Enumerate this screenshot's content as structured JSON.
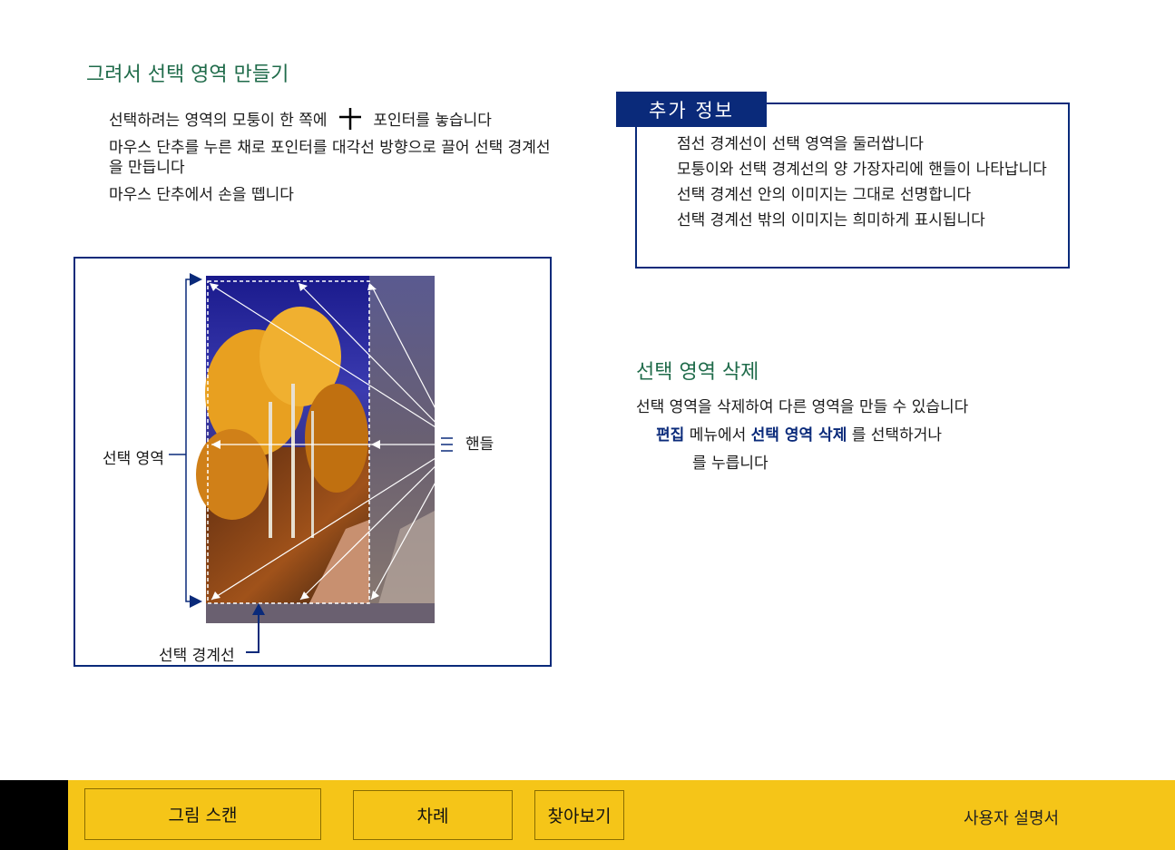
{
  "left_section": {
    "heading": "그려서 선택 영역 만들기",
    "step1_before": "선택하려는 영역의 모퉁이 한 쪽에",
    "step1_after": "포인터를 놓습니다",
    "step2": "마우스 단추를 누른 채로 포인터를 대각선 방향으로 끌어 선택 경계선을 만듭니다",
    "step3": "마우스 단추에서 손을 뗍니다"
  },
  "figure": {
    "label_selection": "선택 영역",
    "label_handles": "핸들",
    "label_marquee": "선택 경계선"
  },
  "info_box": {
    "title": "추가 정보",
    "items": [
      "점선 경계선이 선택 영역을 둘러쌉니다",
      "모퉁이와 선택 경계선의 양 가장자리에 핸들이 나타납니다",
      "선택 경계선 안의 이미지는 그대로 선명합니다",
      "선택 경계선 밖의 이미지는 희미하게 표시됩니다"
    ]
  },
  "delete_section": {
    "heading": "선택 영역 삭제",
    "description": "선택 영역을 삭제하여 다른 영역을 만들 수 있습니다",
    "menu_edit": "편집",
    "step_mid": "메뉴에서",
    "menu_delete": "선택 영역 삭제",
    "step_end": "를 선택하거나",
    "step2": "를 누릅니다"
  },
  "footer": {
    "scan_button": "그림 스캔",
    "toc_button": "차례",
    "search_button": "찾아보기",
    "manual_label": "사용자 설명서"
  },
  "colors": {
    "heading_green": "#1f6b4a",
    "navy": "#0a2a7a",
    "footer_yellow": "#f5c518"
  }
}
